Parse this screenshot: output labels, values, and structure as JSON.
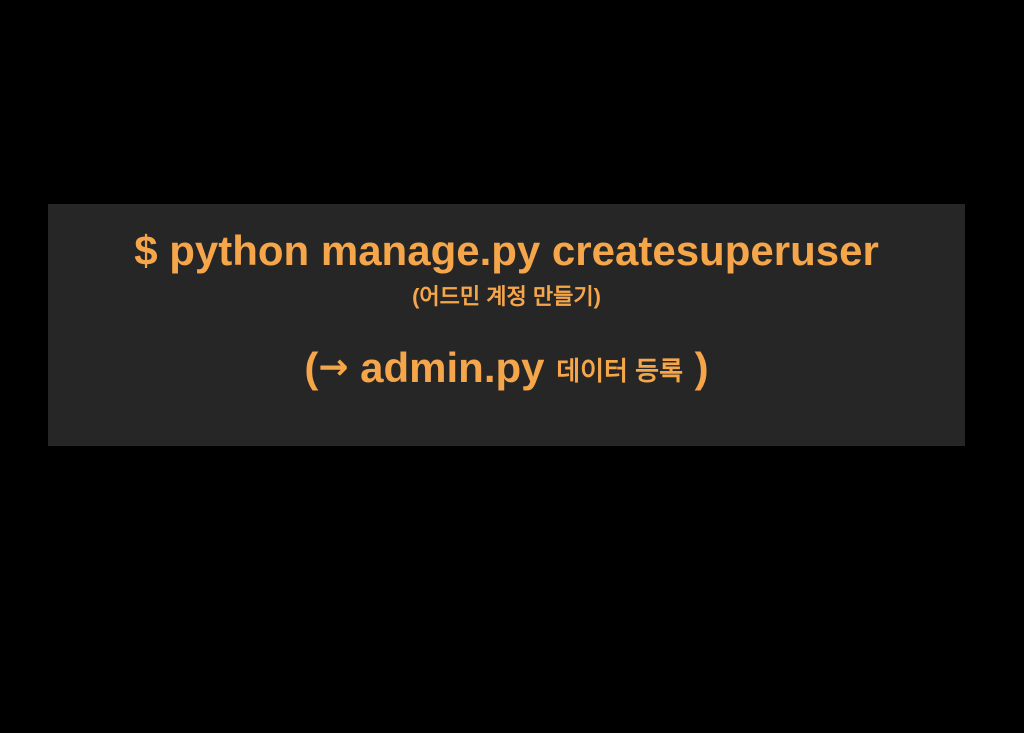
{
  "panel": {
    "command": "$ python manage.py createsuperuser",
    "note_open": "(",
    "note_text": "어드민 계정 만들기",
    "note_close": ")",
    "arrow_open": "(",
    "arrow_icon": "→",
    "arrow_file": " admin.py ",
    "arrow_text": "데이터 등록",
    "arrow_close": " )"
  },
  "colors": {
    "background": "#000000",
    "panel": "#262626",
    "text": "#f5a64a"
  }
}
